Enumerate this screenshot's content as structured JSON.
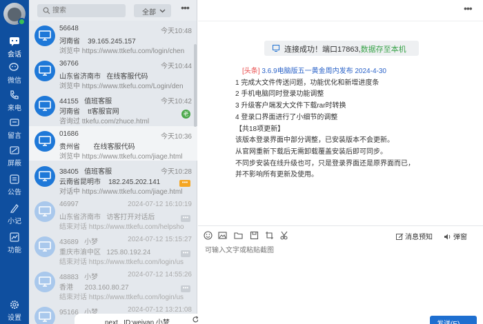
{
  "colors": {
    "nav_bg": "#0f4f9f",
    "list_bg": "#e4e8ed",
    "accent": "#1e78d8",
    "success": "#3aa34a",
    "headline_tag": "#e84a4a",
    "headline_title": "#2a62c8"
  },
  "nav": {
    "items": [
      {
        "label": "会话",
        "icon": "chat-bubble-icon"
      },
      {
        "label": "微信",
        "icon": "wechat-icon"
      },
      {
        "label": "来电",
        "icon": "phone-icon"
      },
      {
        "label": "留言",
        "icon": "message-icon"
      },
      {
        "label": "屏蔽",
        "icon": "block-icon"
      },
      {
        "label": "公告",
        "icon": "notice-icon"
      },
      {
        "label": "小记",
        "icon": "pen-icon"
      },
      {
        "label": "功能",
        "icon": "chart-icon"
      },
      {
        "label": "设置",
        "icon": "gear-icon"
      }
    ]
  },
  "list": {
    "search_placeholder": "搜索",
    "filter_label": "全部",
    "more_label": "•••",
    "items": [
      {
        "id": "56648",
        "name": "",
        "location": "河南省",
        "extra": "39.165.245.157",
        "detail": "浏览中 https://www.ttkefu.com/login/chen",
        "time": "今天10:48",
        "badge": ""
      },
      {
        "id": "36766",
        "name": "",
        "location": "山东省济南市",
        "extra": "在线客服代码",
        "detail": "浏览中 https://www.ttkefu.com/Login/den",
        "time": "今天10:44",
        "badge": ""
      },
      {
        "id": "44155",
        "name": "值班客服",
        "location": "河南省",
        "extra": "tt客服官网",
        "detail": "咨询过 ttkefu.com/zhuce.html",
        "time": "今天10:42",
        "badge": "老"
      },
      {
        "id": "01686",
        "name": "",
        "location": "贵州省",
        "extra": "在线客服代码",
        "detail": "浏览中 https://www.ttkefu.com/jiage.html",
        "time": "今天10:36",
        "badge": ""
      },
      {
        "id": "38405",
        "name": "值班客服",
        "location": "云南省昆明市",
        "extra": "182.245.202.141",
        "detail": "对话中 https://www.ttkefu.com/jiage.html",
        "time": "今天10:28",
        "badge": "•••"
      },
      {
        "id": "46997",
        "name": "",
        "location": "山东省济南市",
        "extra": "访客打开对话后",
        "detail": "结束对话 https://www.ttkefu.com/helpsho",
        "time": "2024-07-12 16:10:19",
        "badge": "•••"
      },
      {
        "id": "43689",
        "name": "小梦",
        "location": "重庆市渝中区",
        "extra": "125.80.192.24",
        "detail": "结束对话 https://www.ttkefu.com/login/us",
        "time": "2024-07-12 15:15:27",
        "badge": "•••"
      },
      {
        "id": "48883",
        "name": "小梦",
        "location": "香港",
        "extra": "203.160.80.27",
        "detail": "结束对话 https://www.ttkefu.com/login/us",
        "time": "2024-07-12 14:55:26",
        "badge": "•••"
      },
      {
        "id": "95166",
        "name": "小梦",
        "location": "",
        "extra": "",
        "detail": "",
        "time": "2024-07-12 13:21:08",
        "badge": ""
      }
    ],
    "bottom_tab": "next.. ID:weiyan 小梦"
  },
  "chat": {
    "more_label": "•••",
    "notice_prefix": "连接成功！端口17863,",
    "notice_suffix": "数据存至本机",
    "headline_tag": "[头条]",
    "headline_title": "3.6.9电脑版五一黄金周内发布 2024-4-30",
    "lines": [
      "1 完成大文件传送问题，功能优化和新增进度条",
      "2 手机电脑同时登录功能调整",
      "3 升级客户端发大文件下载rar时转换",
      "4 登录口界面进行了小细节的调整",
      "【共18项更新】",
      "该版本登录界面中部分调整，已安装版本不会更新。",
      "从官网重新下载后无需卸载覆盖安装后即可同步。",
      "不同步安装在线升级也可，只是登录界面还是原界面而已，",
      "并不影响所有更新及使用。"
    ],
    "toolbar": {
      "voice_label": "消息预知",
      "bar_label": "弹窗"
    },
    "input_placeholder": "可输入文字或粘贴截图",
    "send_label": "发送(E)"
  }
}
